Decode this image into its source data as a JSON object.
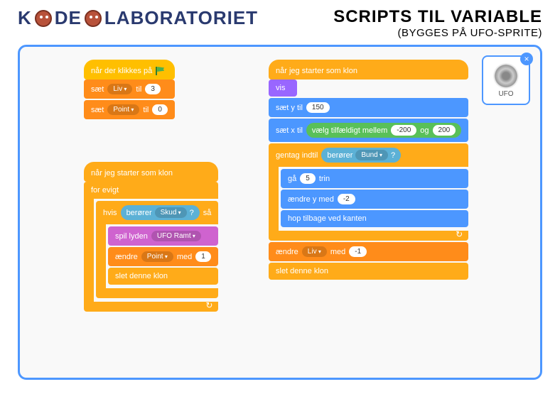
{
  "logo": {
    "part1": "K",
    "part2": "DE",
    "part3": "LABORATORIET"
  },
  "title": {
    "main": "SCRIPTS TIL VARIABLE",
    "sub": "(BYGGES PÅ UFO-SPRITE)"
  },
  "sprite": {
    "label": "UFO"
  },
  "scriptA": {
    "hat": "når der klikkes på",
    "set_liv": {
      "action": "sæt",
      "var": "Liv",
      "to": "til",
      "val": "3"
    },
    "set_point": {
      "action": "sæt",
      "var": "Point",
      "to": "til",
      "val": "0"
    }
  },
  "scriptB": {
    "hat": "når jeg starter som klon",
    "forever": "for evigt",
    "if": "hvis",
    "then": "så",
    "touch": "berører",
    "touch_arg": "Skud",
    "q": "?",
    "play_sound": "spil lyden",
    "sound": "UFO Ramt",
    "change": "ændre",
    "var": "Point",
    "by": "med",
    "val": "1",
    "delete": "slet denne klon"
  },
  "scriptC": {
    "hat": "når jeg starter som klon",
    "show": "vis",
    "sety": "sæt y til",
    "sety_val": "150",
    "setx": "sæt x til",
    "rand": "vælg tilfældigt mellem",
    "rand_lo": "-200",
    "rand_and": "og",
    "rand_hi": "200",
    "repeat_until": "gentag indtil",
    "touch": "berører",
    "touch_arg": "Bund",
    "q": "?",
    "move": "gå",
    "move_val": "5",
    "move_unit": "trin",
    "changey": "ændre y med",
    "changey_val": "-2",
    "bounce": "hop tilbage ved kanten",
    "change": "ændre",
    "var": "Liv",
    "by": "med",
    "val": "-1",
    "delete": "slet denne klon"
  }
}
